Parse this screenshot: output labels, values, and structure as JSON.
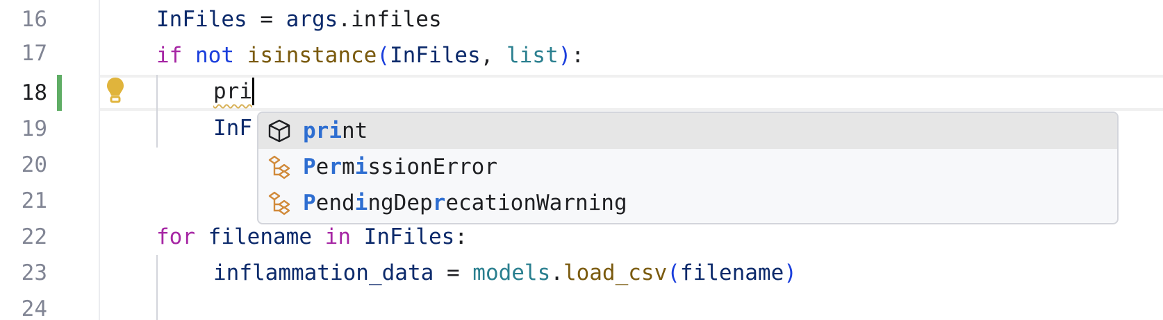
{
  "gutter": {
    "line_numbers": [
      "16",
      "17",
      "18",
      "19",
      "20",
      "21",
      "22",
      "23",
      "24"
    ]
  },
  "code": {
    "line16": {
      "a": "InFiles",
      "b": " = ",
      "c": "args",
      "d": ".",
      "e": "infiles"
    },
    "line17": {
      "kw1": "if",
      "sp1": " ",
      "kw2": "not",
      "sp2": " ",
      "fn": "isinstance",
      "p1": "(",
      "arg1": "InFiles",
      "comma": ", ",
      "arg2": "list",
      "p2": ")",
      "colon": ":"
    },
    "line18": {
      "typed": "pri"
    },
    "line19": {
      "visible": "InF"
    },
    "line22": {
      "kw1": "for",
      "sp1": " ",
      "var": "filename",
      "sp2": " ",
      "kw2": "in",
      "sp3": " ",
      "iter": "InFiles",
      "colon": ":"
    },
    "line23": {
      "var": "inflammation_data",
      "eq": " = ",
      "mod": "models",
      "dot": ".",
      "fn": "load_csv",
      "p1": "(",
      "arg": "filename",
      "p2": ")"
    }
  },
  "completion": {
    "items": [
      {
        "kind": "function",
        "icon": "cube-icon",
        "parts": [
          {
            "t": "pri",
            "m": true
          },
          {
            "t": "nt",
            "m": false
          }
        ]
      },
      {
        "kind": "class",
        "icon": "class-hierarchy-icon",
        "parts": [
          {
            "t": "P",
            "m": true
          },
          {
            "t": "e",
            "m": false
          },
          {
            "t": "r",
            "m": true
          },
          {
            "t": "m",
            "m": false
          },
          {
            "t": "i",
            "m": true
          },
          {
            "t": "ssionError",
            "m": false
          }
        ]
      },
      {
        "kind": "class",
        "icon": "class-hierarchy-icon",
        "parts": [
          {
            "t": "P",
            "m": true
          },
          {
            "t": "end",
            "m": false
          },
          {
            "t": "i",
            "m": true
          },
          {
            "t": "ngDep",
            "m": false
          },
          {
            "t": "r",
            "m": true
          },
          {
            "t": "ecationWarning",
            "m": false
          }
        ]
      }
    ]
  },
  "colors": {
    "match": "#2e6ed1",
    "change_marker": "#5fad65",
    "bulb": "#e0b43c",
    "class_icon": "#d18a3a"
  }
}
